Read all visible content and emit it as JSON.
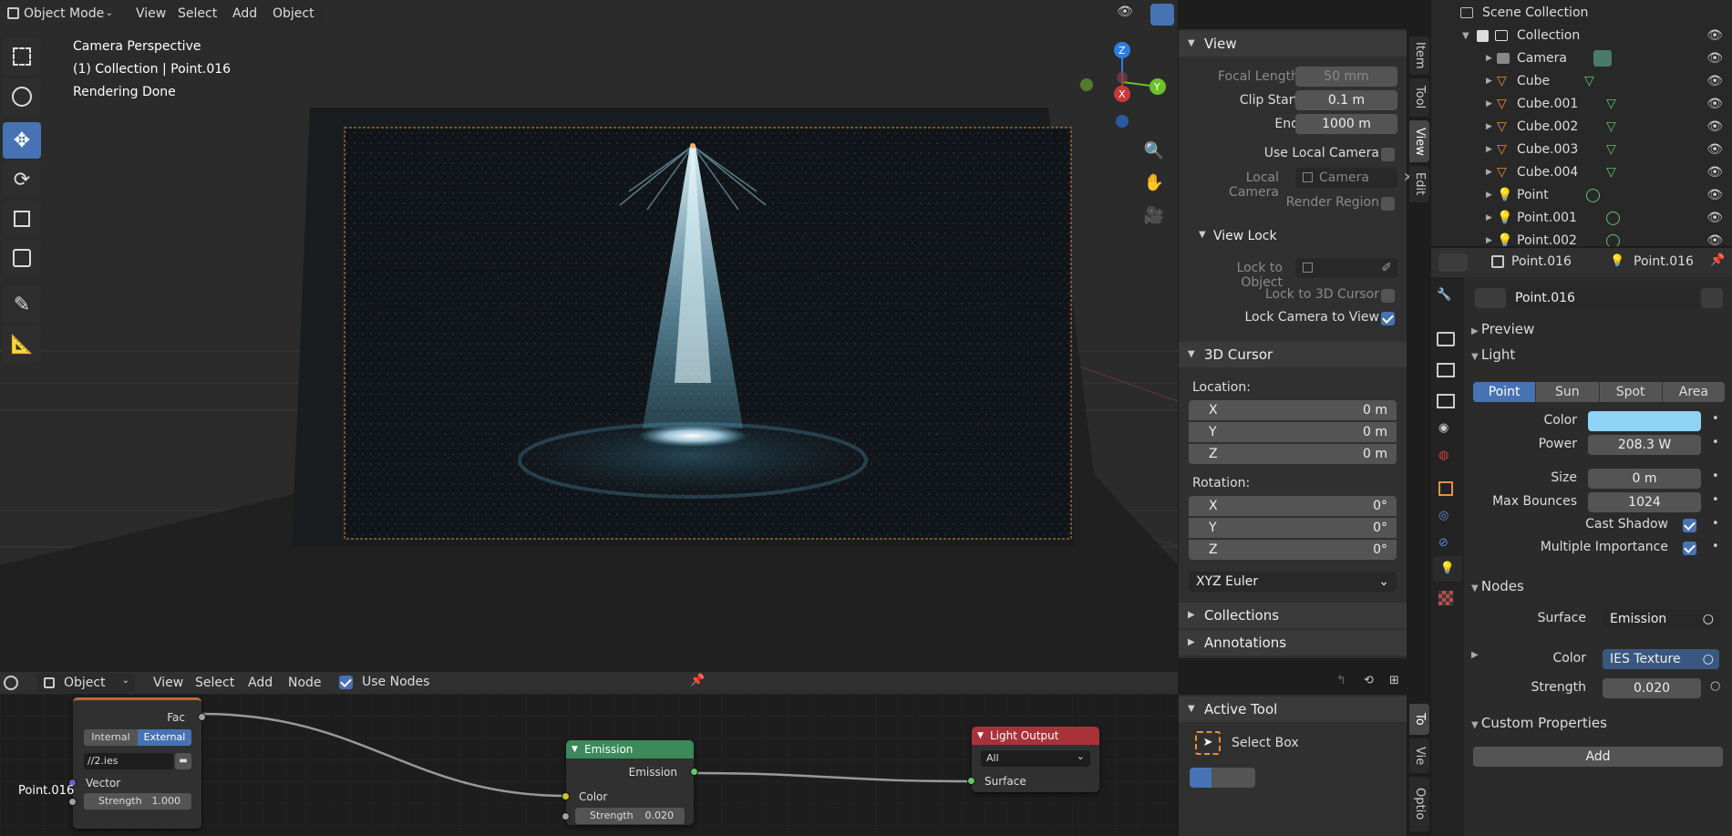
{
  "viewport_header": {
    "mode": "Object Mode",
    "menus": [
      "View",
      "Select",
      "Add",
      "Object"
    ]
  },
  "viewport_info": {
    "line1": "Camera Perspective",
    "line2": "(1) Collection | Point.016",
    "line3": "Rendering Done"
  },
  "gizmo": {
    "x": "X",
    "y": "Y",
    "z": "Z"
  },
  "side_tabs": [
    "Item",
    "Tool",
    "View",
    "Edit"
  ],
  "npanel": {
    "view": {
      "title": "View",
      "focal_length_label": "Focal Length",
      "focal_length": "50 mm",
      "clip_start_label": "Clip Start",
      "clip_start": "0.1 m",
      "end_label": "End",
      "end": "1000 m",
      "use_local_camera": "Use Local Camera",
      "local_camera_label": "Local Camera",
      "local_camera": "Camera",
      "render_region": "Render Region"
    },
    "view_lock": {
      "title": "View Lock",
      "lock_to_object": "Lock to Object",
      "lock_to_3d_cursor": "Lock to 3D Cursor",
      "lock_camera_to_view": "Lock Camera to View"
    },
    "cursor": {
      "title": "3D Cursor",
      "location_label": "Location:",
      "rotation_label": "Rotation:",
      "loc": [
        {
          "axis": "X",
          "value": "0 m"
        },
        {
          "axis": "Y",
          "value": "0 m"
        },
        {
          "axis": "Z",
          "value": "0 m"
        }
      ],
      "rot": [
        {
          "axis": "X",
          "value": "0°"
        },
        {
          "axis": "Y",
          "value": "0°"
        },
        {
          "axis": "Z",
          "value": "0°"
        }
      ],
      "rotation_mode": "XYZ Euler"
    },
    "collections": "Collections",
    "annotations": "Annotations",
    "active_tool": {
      "title": "Active Tool",
      "tool": "Select Box"
    }
  },
  "lower_tabs": [
    "To",
    "Vie",
    "Optio"
  ],
  "outliner": {
    "title": "Scene Collection",
    "collection": "Collection",
    "items": [
      "Camera",
      "Cube",
      "Cube.001",
      "Cube.002",
      "Cube.003",
      "Cube.004",
      "Point",
      "Point.001",
      "Point.002"
    ]
  },
  "properties": {
    "header_object": "Point.016",
    "header_data": "Point.016",
    "data_name": "Point.016",
    "preview": "Preview",
    "light_title": "Light",
    "light_types": [
      "Point",
      "Sun",
      "Spot",
      "Area"
    ],
    "color_label": "Color",
    "power_label": "Power",
    "power": "208.3 W",
    "size_label": "Size",
    "size": "0 m",
    "max_bounces_label": "Max Bounces",
    "max_bounces": "1024",
    "cast_shadow": "Cast Shadow",
    "multiple_importance": "Multiple Importance",
    "nodes_title": "Nodes",
    "surface_label": "Surface",
    "surface": "Emission",
    "ncolor_label": "Color",
    "ncolor": "IES Texture",
    "strength_label": "Strength",
    "strength": "0.020",
    "custom_props": "Custom Properties",
    "add": "Add",
    "light_color": "#8fd3f4"
  },
  "node_editor": {
    "object_type": "Object",
    "menus": [
      "View",
      "Select",
      "Add",
      "Node"
    ],
    "use_nodes": "Use Nodes",
    "ies": {
      "fac": "Fac",
      "internal": "Internal",
      "external": "External",
      "file": "//2.ies",
      "vector": "Vector",
      "strength_label": "Strength",
      "strength": "1.000"
    },
    "frame_label": "Point.016",
    "emission": {
      "title": "Emission",
      "out": "Emission",
      "color": "Color",
      "strength_label": "Strength",
      "strength": "0.020"
    },
    "output": {
      "title": "Light Output",
      "target": "All",
      "surface": "Surface"
    }
  }
}
